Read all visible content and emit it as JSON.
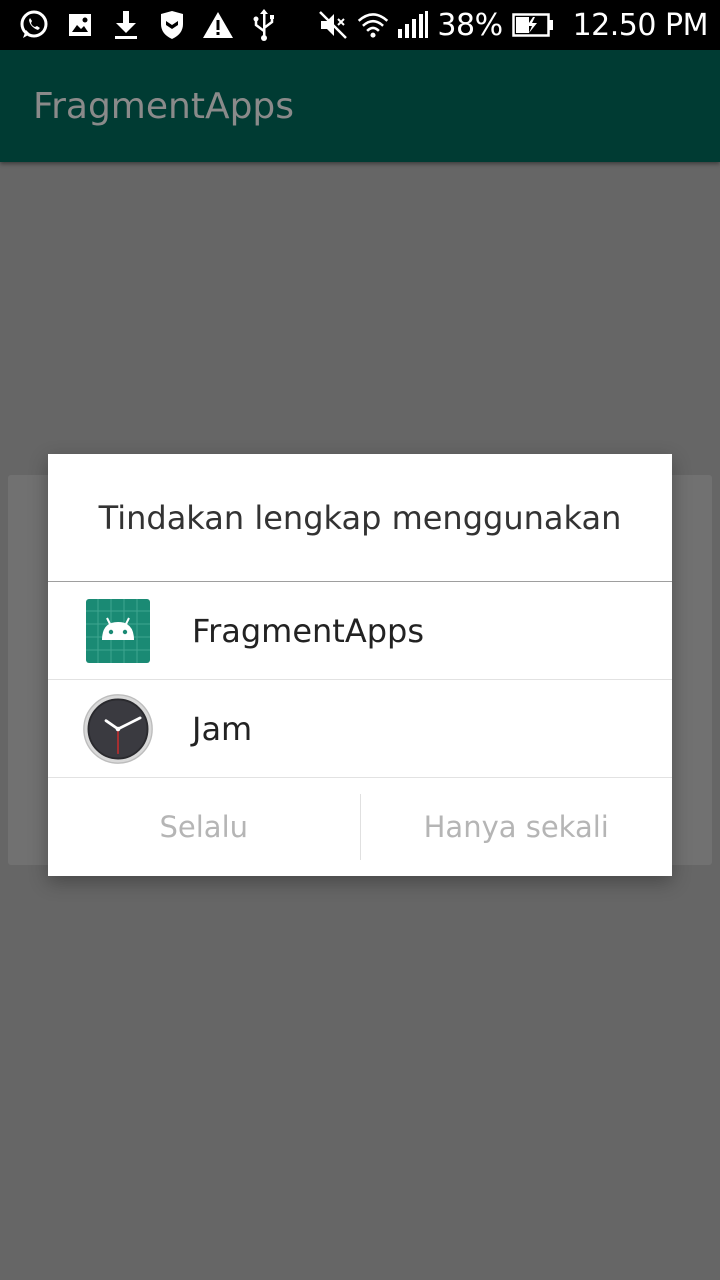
{
  "status_bar": {
    "left_icons": [
      "whatsapp-icon",
      "image-icon",
      "download-icon",
      "shield-icon",
      "warning-icon",
      "usb-icon"
    ],
    "right_icons": [
      "mute-icon",
      "wifi-icon",
      "signal-icon",
      "battery-charging-icon"
    ],
    "battery_percent": "38%",
    "time": "12.50 PM"
  },
  "app_bar": {
    "title": "FragmentApps"
  },
  "dialog": {
    "title": "Tindakan lengkap menggunakan",
    "options": [
      {
        "label": "FragmentApps",
        "icon": "android-app-icon"
      },
      {
        "label": "Jam",
        "icon": "clock-app-icon"
      }
    ],
    "buttons": {
      "always": "Selalu",
      "just_once": "Hanya sekali"
    }
  },
  "colors": {
    "status_bar": "#000000",
    "app_bar": "#003b33",
    "scrim": "#666666",
    "app_icon_green": "#1a8a74",
    "disabled_text": "#b5b5b5"
  }
}
